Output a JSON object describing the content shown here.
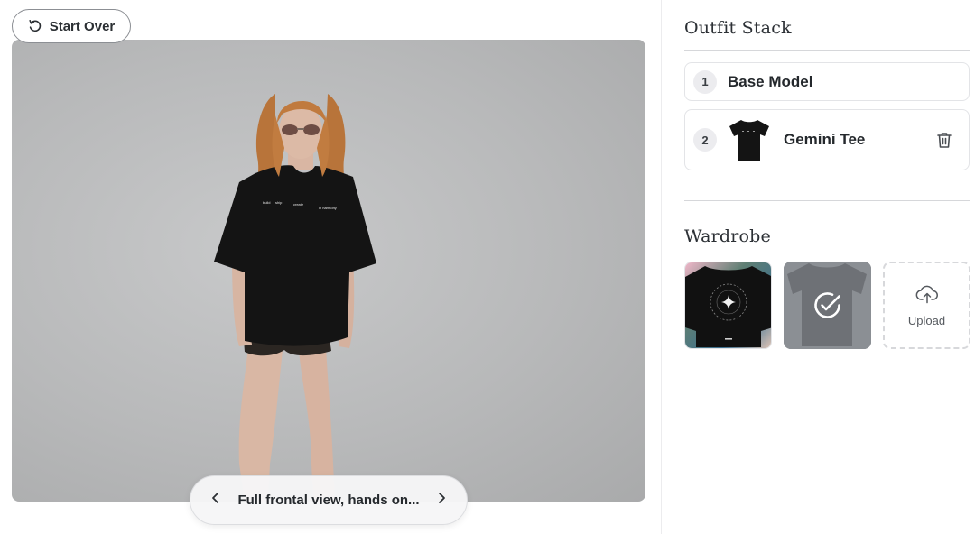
{
  "toolbar": {
    "start_over_label": "Start Over"
  },
  "canvas": {
    "pose_label": "Full frontal view, hands on...",
    "tee_print_words": [
      "build",
      "ship",
      "create",
      "in harmony"
    ]
  },
  "outfit_stack": {
    "title": "Outfit Stack",
    "items": [
      {
        "index": "1",
        "name": "Base Model"
      },
      {
        "index": "2",
        "name": "Gemini Tee"
      }
    ]
  },
  "wardrobe": {
    "title": "Wardrobe",
    "items": [
      {
        "name": "gemini-sweatshirt",
        "selected": false
      },
      {
        "name": "grey-tee",
        "selected": true
      }
    ],
    "upload_label": "Upload"
  },
  "icons": {
    "start_over": "rotate-ccw-icon",
    "prev": "chevron-left-icon",
    "next": "chevron-right-icon",
    "delete": "trash-icon",
    "selected": "check-circle-icon",
    "upload": "cloud-upload-icon"
  },
  "colors": {
    "accent_border": "#8c8f94",
    "photo_bg": "#b9babb",
    "garment": "#141414"
  }
}
